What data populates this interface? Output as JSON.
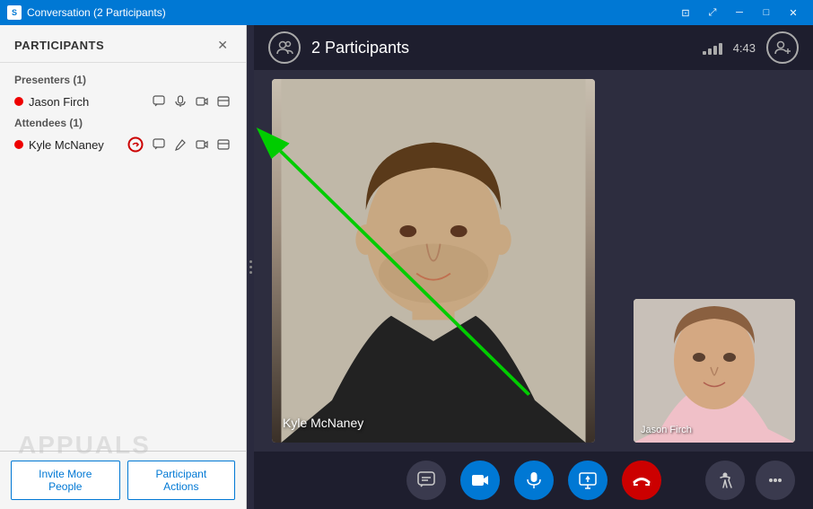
{
  "titleBar": {
    "title": "Conversation (2 Participants)",
    "appIcon": "S",
    "controls": {
      "tile": "⊡",
      "restore": "⤢",
      "minimize": "─",
      "maximize": "□",
      "close": "✕"
    }
  },
  "leftPanel": {
    "title": "PARTICIPANTS",
    "closeLabel": "✕",
    "sections": [
      {
        "label": "Presenters (1)",
        "participants": [
          {
            "name": "Jason Firch",
            "dotColor": "red",
            "hasChat": true,
            "hasMic": true,
            "hasCam": true,
            "hasShare": true
          }
        ]
      },
      {
        "label": "Attendees (1)",
        "participants": [
          {
            "name": "Kyle McNaney",
            "dotColor": "red",
            "hasAction": true,
            "hasChat": true,
            "hasPen": true,
            "hasCam": true,
            "hasShare": true
          }
        ]
      }
    ],
    "footer": {
      "inviteLabel": "Invite More People",
      "actionsLabel": "Participant Actions"
    }
  },
  "videoArea": {
    "topBar": {
      "participantsCount": "2 Participants",
      "time": "4:43",
      "addBtnLabel": "+"
    },
    "mainVideo": {
      "personName": "Kyle McNaney"
    },
    "secondaryVideo": {
      "personName": "Jason Firch"
    },
    "controls": [
      {
        "id": "chat-ctrl",
        "icon": "💬",
        "style": "gray",
        "label": "Chat"
      },
      {
        "id": "video-ctrl",
        "icon": "🎥",
        "style": "blue",
        "label": "Video"
      },
      {
        "id": "mic-ctrl",
        "icon": "🎤",
        "style": "blue",
        "label": "Mic"
      },
      {
        "id": "screen-ctrl",
        "icon": "🖥",
        "style": "blue",
        "label": "Screen"
      },
      {
        "id": "end-ctrl",
        "icon": "📞",
        "style": "red",
        "label": "End"
      }
    ],
    "rightControls": [
      {
        "id": "accessibility-ctrl",
        "icon": "♿",
        "style": "gray",
        "label": "Accessibility"
      },
      {
        "id": "more-ctrl",
        "icon": "•••",
        "style": "gray",
        "label": "More"
      }
    ]
  },
  "watermark": {
    "text": "APPUALS"
  },
  "annotation": {
    "arrowColor": "#00cc00",
    "label": "Kyle action icon arrow"
  }
}
